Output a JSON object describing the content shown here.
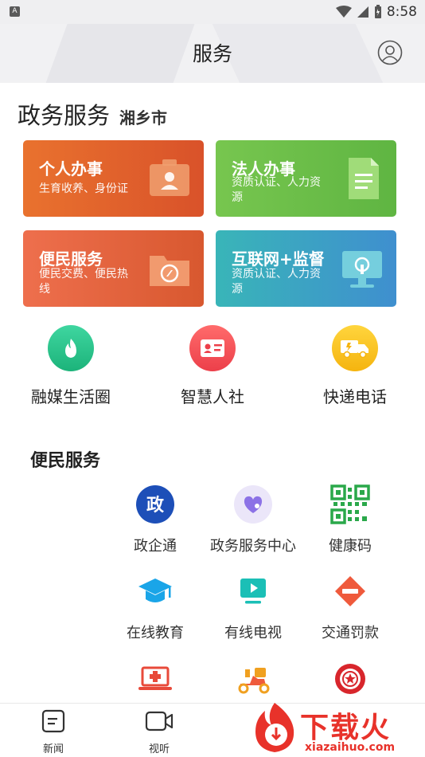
{
  "status_bar": {
    "notification_icon": "A",
    "time": "8:58",
    "icons": [
      "wifi-icon",
      "signal-icon",
      "battery-icon"
    ]
  },
  "header": {
    "title": "服务",
    "profile_icon": "user-circle-icon"
  },
  "gov_section": {
    "title": "政务服务",
    "city": "湘乡市"
  },
  "cards": [
    {
      "title": "个人办事",
      "subtitle": "生育收养、身份证",
      "icon": "id-card-icon"
    },
    {
      "title": "法人办事",
      "subtitle": "资质认证、人力资源",
      "icon": "document-icon"
    },
    {
      "title": "便民服务",
      "subtitle": "便民交费、便民热线",
      "icon": "compass-folder-icon"
    },
    {
      "title": "互联网+监督",
      "subtitle": "资质认证、人力资源",
      "icon": "monitor-icon"
    }
  ],
  "round_services": [
    {
      "label": "融媒生活圈",
      "icon": "flame-icon",
      "color": "#1cb37a"
    },
    {
      "label": "智慧人社",
      "icon": "id-card-icon",
      "color": "#ec3f4a"
    },
    {
      "label": "快递电话",
      "icon": "truck-icon",
      "color": "#f5b40f"
    }
  ],
  "convenience": {
    "title": "便民服务",
    "items": [
      {
        "label": "政企通",
        "icon": "zheng-icon"
      },
      {
        "label": "政务服务中心",
        "icon": "heart-shield-icon"
      },
      {
        "label": "健康码",
        "icon": "qr-code-icon"
      },
      {
        "label": "在线教育",
        "icon": "graduation-cap-icon"
      },
      {
        "label": "有线电视",
        "icon": "tv-play-icon"
      },
      {
        "label": "交通罚款",
        "icon": "no-entry-icon"
      },
      {
        "label": "",
        "icon": "medical-laptop-icon"
      },
      {
        "label": "",
        "icon": "scooter-icon"
      },
      {
        "label": "",
        "icon": "police-badge-icon"
      }
    ]
  },
  "bottom_nav": [
    {
      "label": "新闻",
      "icon": "news-icon"
    },
    {
      "label": "视听",
      "icon": "video-camera-icon"
    }
  ],
  "watermark": {
    "text": "下载火",
    "url": "xiazaihuo.com"
  }
}
